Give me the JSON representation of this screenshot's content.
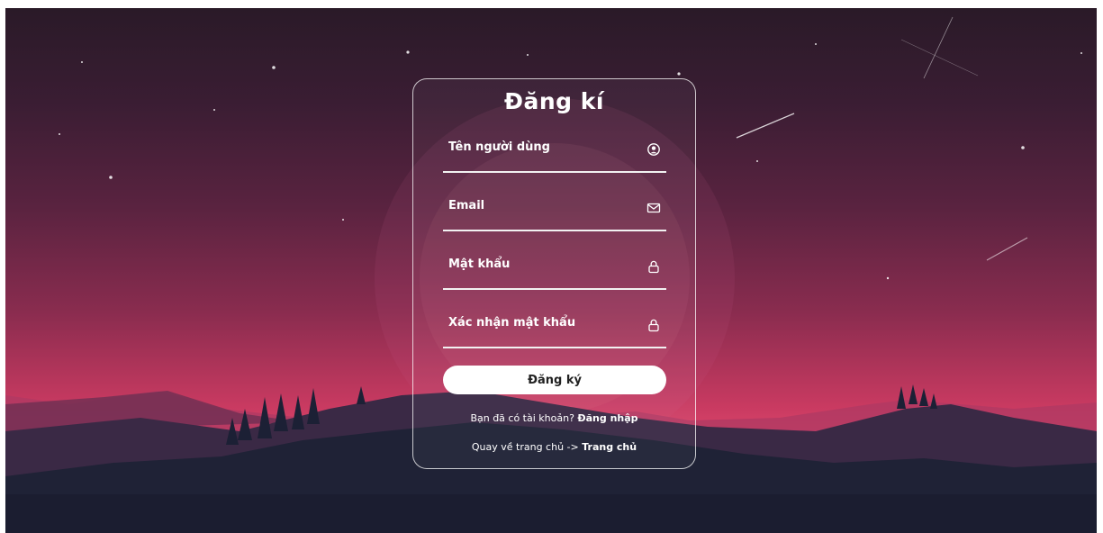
{
  "form": {
    "title": "Đăng kí",
    "fields": [
      {
        "label": "Tên người dùng",
        "icon": "user-circle-icon"
      },
      {
        "label": "Email",
        "icon": "envelope-icon"
      },
      {
        "label": "Mật khẩu",
        "icon": "lock-icon"
      },
      {
        "label": "Xác nhận mật khẩu",
        "icon": "lock-icon"
      }
    ],
    "submit_label": "Đăng ký",
    "login_prompt": "Bạn đã có tài khoản?",
    "login_link": "Đăng nhập",
    "home_prompt": "Quay về trang chủ ->",
    "home_link": "Trang chủ"
  },
  "colors": {
    "accent": "#ffffff",
    "sky_top": "#2a1a28",
    "horizon": "#e24a6e",
    "ground": "#202239"
  }
}
